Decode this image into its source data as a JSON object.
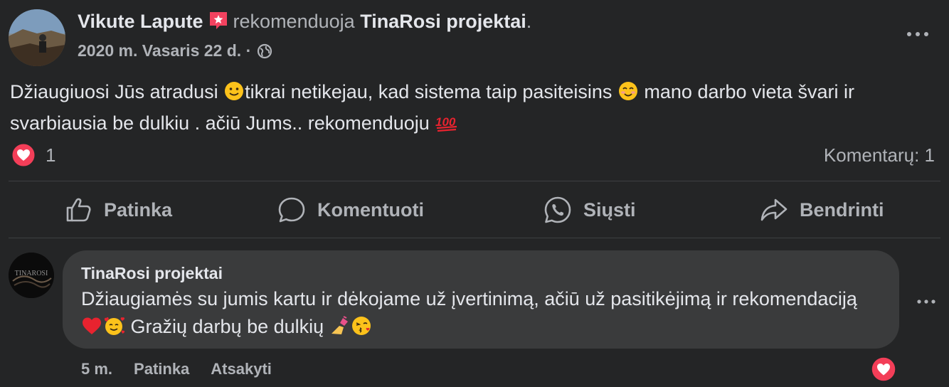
{
  "post": {
    "author": "Vikute Lapute",
    "verb": "rekomenduoja",
    "page": "TinaRosi projektai",
    "period": ".",
    "date": "2020 m. Vasaris 22 d.",
    "dot": "·",
    "text_parts": [
      "Džiaugiuosi Jūs atradusi ",
      "tikrai netikejau, kad sistema taip pasiteisins ",
      " mano darbo vieta švari ir svarbiausia be dulkiu . ačiū Jums.. rekomenduoju "
    ],
    "reaction_count": "1",
    "comment_count": "Komentarų: 1"
  },
  "actions": {
    "like": "Patinka",
    "comment": "Komentuoti",
    "send": "Siųsti",
    "share": "Bendrinti"
  },
  "comment": {
    "author": "TinaRosi projektai",
    "text_parts": [
      "Džiaugiamės su jumis kartu ir dėkojame už įvertinimą, ačiū už pasitikėjimą ir rekomendaciją ",
      " Gražių darbų be dulkių "
    ],
    "time": "5 m.",
    "like": "Patinka",
    "reply": "Atsakyti",
    "avatar_text": "TINAROSI"
  },
  "colors": {
    "background": "#242526",
    "bubble": "#3a3b3c",
    "text": "#e4e6eb",
    "muted": "#b0b3b8",
    "heart": "#f33e58"
  },
  "icons": [
    "star-badge-icon",
    "globe-icon",
    "more-icon",
    "heart-icon",
    "thumbs-up-icon",
    "comment-icon",
    "whatsapp-icon",
    "share-icon"
  ]
}
